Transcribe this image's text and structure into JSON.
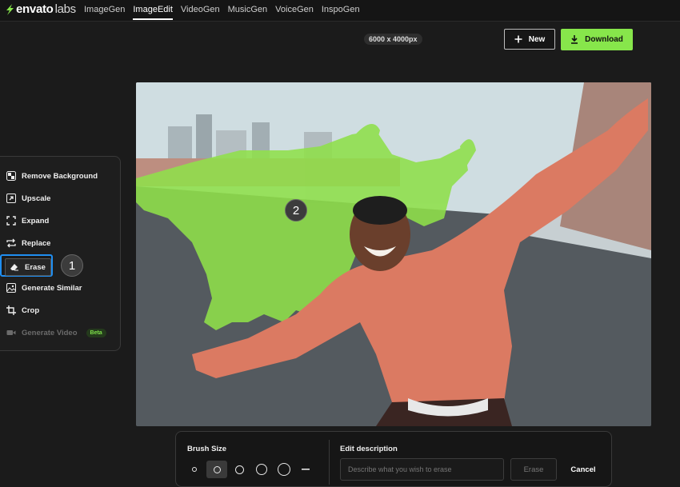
{
  "brand": {
    "name_bold": "envato",
    "name_light": "labs"
  },
  "nav": {
    "links": [
      {
        "label": "ImageGen"
      },
      {
        "label": "ImageEdit"
      },
      {
        "label": "VideoGen"
      },
      {
        "label": "MusicGen"
      },
      {
        "label": "VoiceGen"
      },
      {
        "label": "InspoGen"
      }
    ],
    "active": "ImageEdit"
  },
  "canvas": {
    "dimensions": "6000 x 4000px"
  },
  "actions": {
    "new_label": "New",
    "download_label": "Download"
  },
  "tools": [
    {
      "label": "Remove Background",
      "icon": "checker-icon"
    },
    {
      "label": "Upscale",
      "icon": "upscale-icon"
    },
    {
      "label": "Expand",
      "icon": "expand-icon"
    },
    {
      "label": "Replace",
      "icon": "replace-icon"
    },
    {
      "label": "Erase",
      "icon": "eraser-icon",
      "selected": true
    },
    {
      "label": "Generate Similar",
      "icon": "images-icon"
    },
    {
      "label": "Crop",
      "icon": "crop-icon"
    },
    {
      "label": "Generate Video",
      "icon": "video-icon",
      "disabled": true,
      "badge": "Beta"
    }
  ],
  "annotations": {
    "step1": "1",
    "step2": "2"
  },
  "editor": {
    "brush_size_label": "Brush Size",
    "brush_sizes_count": 5,
    "selected_brush_index": 1,
    "edit_description_label": "Edit description",
    "description_placeholder": "Describe what you wish to erase",
    "erase_label": "Erase",
    "cancel_label": "Cancel"
  },
  "colors": {
    "accent_green": "#87e64b",
    "highlight_blue": "#1f8ef1",
    "mask_green": "#8fe04a"
  }
}
